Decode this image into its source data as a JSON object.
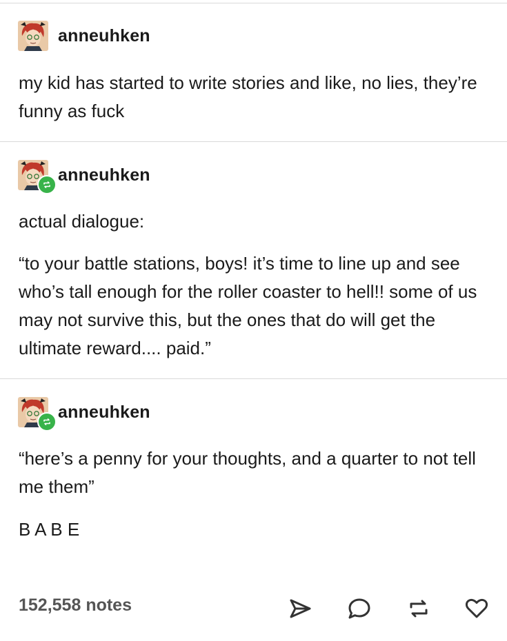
{
  "posts": [
    {
      "username": "anneuhken",
      "reblog": false,
      "paragraphs": [
        "my kid has started to write stories and like, no lies, they’re funny as fuck"
      ]
    },
    {
      "username": "anneuhken",
      "reblog": true,
      "paragraphs": [
        "actual dialogue:",
        "“to your battle stations, boys! it’s time to line up and see who’s tall enough for the roller coaster to hell!! some of us may not survive this, but the ones that do will get the ultimate reward.... paid.”"
      ]
    },
    {
      "username": "anneuhken",
      "reblog": true,
      "paragraphs": [
        "“here’s a penny for your thoughts, and a quarter to not tell me them”",
        "B A B E"
      ]
    }
  ],
  "footer": {
    "notes": "152,558 notes",
    "actions": [
      "send-icon",
      "comment-icon",
      "reblog-icon",
      "like-icon"
    ]
  },
  "colors": {
    "text": "#1a1a1a",
    "muted": "#555555",
    "reblog_badge": "#38b34a",
    "divider": "#d9d9d9"
  }
}
